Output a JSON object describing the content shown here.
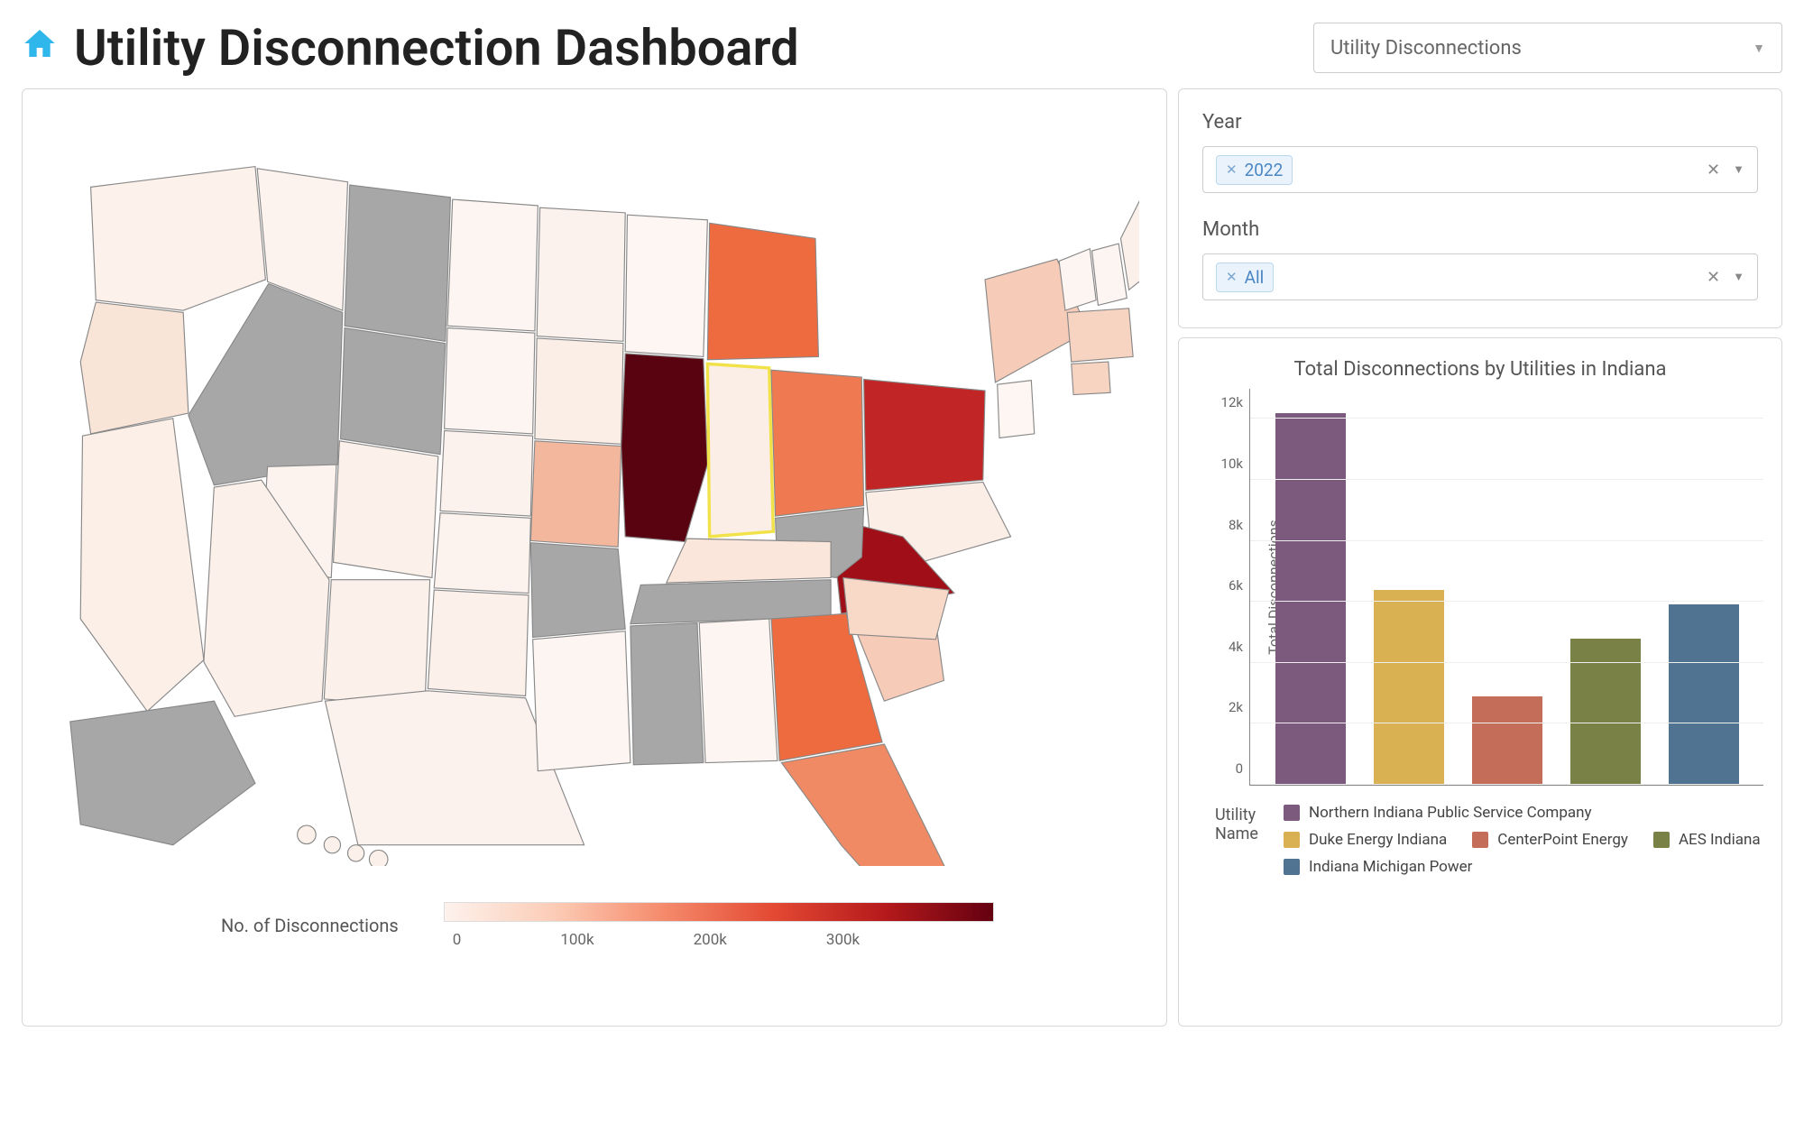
{
  "header": {
    "title": "Utility Disconnection Dashboard",
    "home_icon": "home-icon",
    "metric_select": {
      "selected": "Utility Disconnections"
    }
  },
  "filters": {
    "year": {
      "label": "Year",
      "selected": "2022"
    },
    "month": {
      "label": "Month",
      "selected": "All"
    }
  },
  "map": {
    "legend_label": "No. of Disconnections",
    "legend_ticks": [
      "0",
      "100k",
      "200k",
      "300k"
    ],
    "colorscale_range": [
      0,
      350000
    ],
    "highlighted_state": "Indiana"
  },
  "chart_data": {
    "type": "bar",
    "title": "Total Disconnections by Utilities in Indiana",
    "ylabel": "Total Disconnections",
    "xlabel": "Utility Name",
    "ylim": [
      0,
      13000
    ],
    "yticks": [
      0,
      2000,
      4000,
      6000,
      8000,
      10000,
      12000
    ],
    "ytick_labels": [
      "0",
      "2k",
      "4k",
      "6k",
      "8k",
      "10k",
      "12k"
    ],
    "series": [
      {
        "name": "Northern Indiana Public Service Company",
        "value": 12200,
        "color": "#7b5a7e"
      },
      {
        "name": "Duke Energy Indiana",
        "value": 6400,
        "color": "#d9b052"
      },
      {
        "name": "CenterPoint Energy",
        "value": 2900,
        "color": "#c46d59"
      },
      {
        "name": "AES Indiana",
        "value": 4800,
        "color": "#7a8146"
      },
      {
        "name": "Indiana Michigan Power",
        "value": 5900,
        "color": "#4f7390"
      }
    ]
  }
}
